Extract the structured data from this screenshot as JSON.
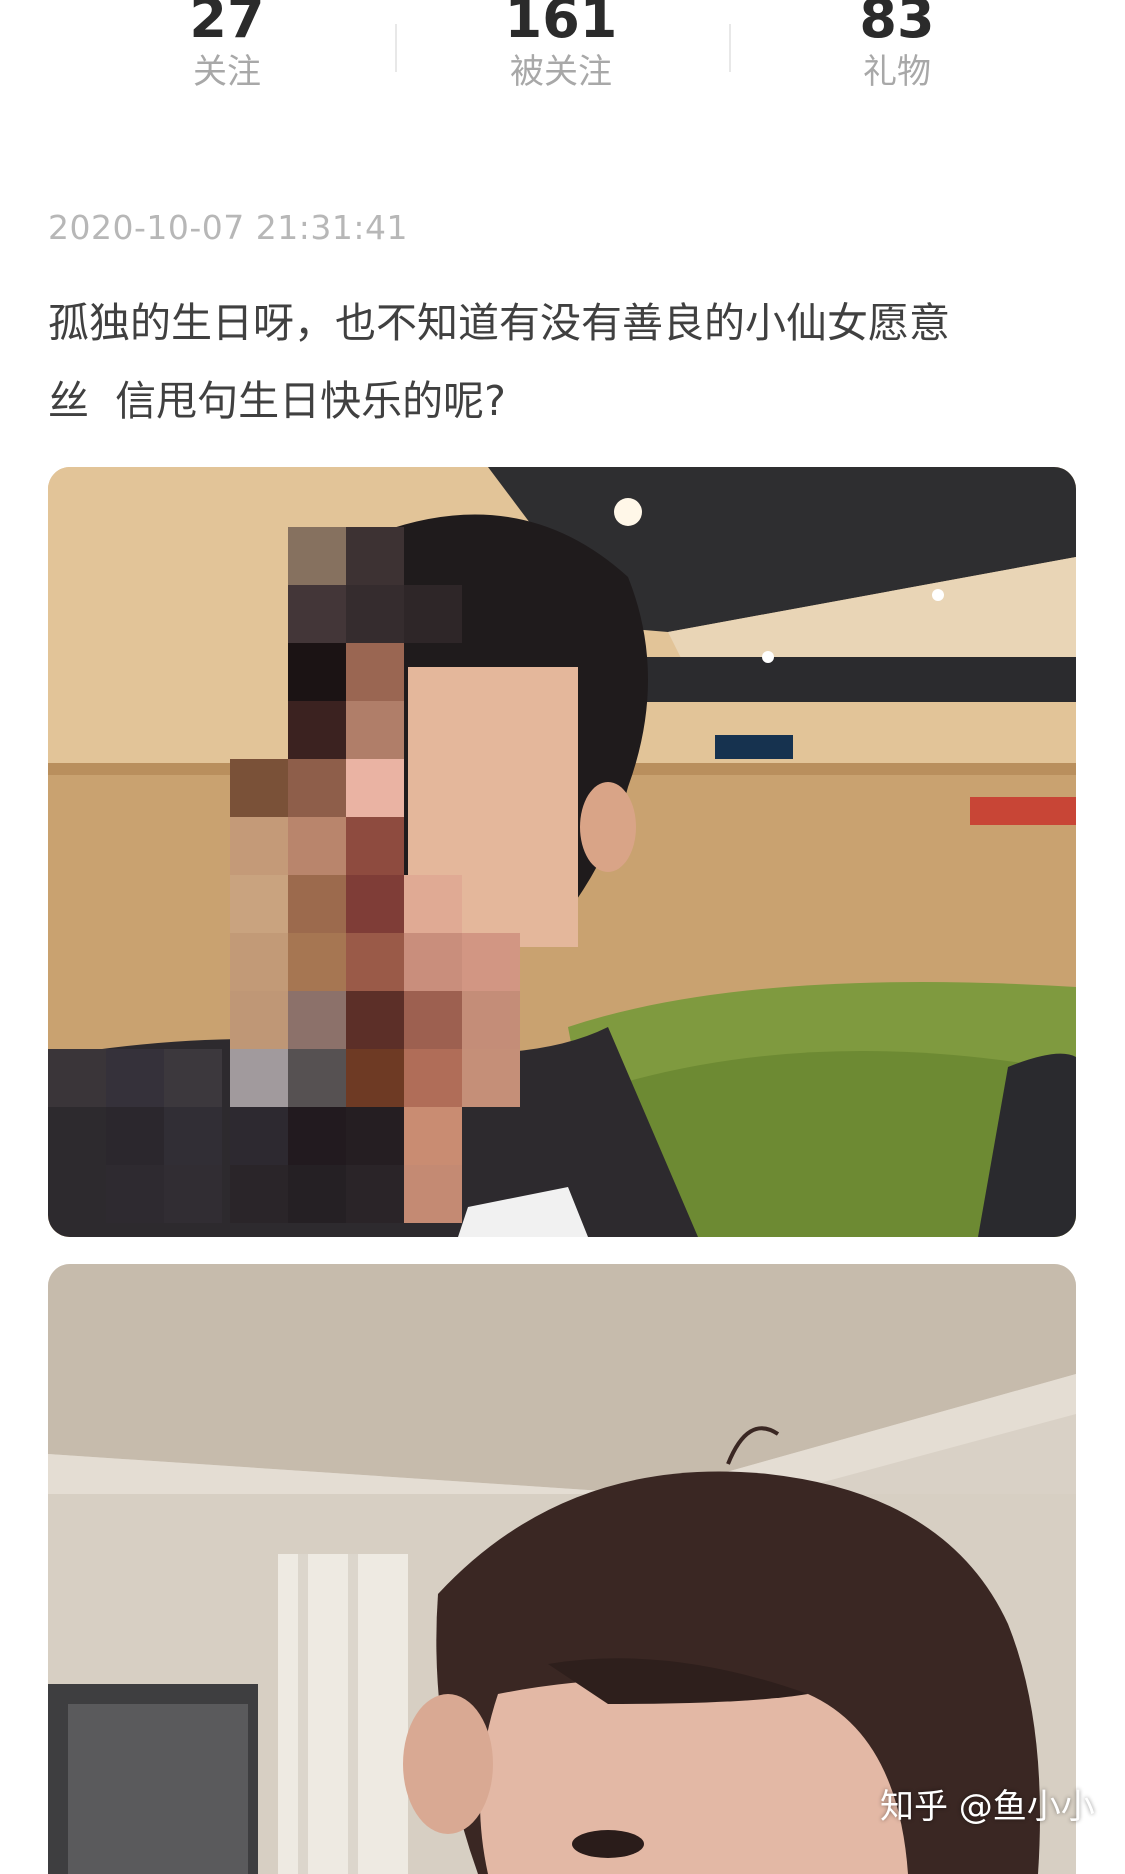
{
  "profile_stats": [
    {
      "count": "27",
      "label": "关注"
    },
    {
      "count": "161",
      "label": "被关注"
    },
    {
      "count": "83",
      "label": "礼物"
    }
  ],
  "post": {
    "timestamp": "2020-10-07 21:31:41",
    "text": "孤独的生日呀，也不知道有没有善良的小仙女愿意\n丝  信甩句生日快乐的呢?",
    "images": [
      {
        "name": "selfie-photo-restaurant"
      },
      {
        "name": "selfie-photo-hotel-room"
      }
    ]
  },
  "watermark": "知乎 @鱼小小",
  "colors": {
    "count_text": "#2b2b2b",
    "label_text": "#a8a8a8",
    "timestamp_text": "#b7b7b7",
    "body_text": "#404040"
  }
}
